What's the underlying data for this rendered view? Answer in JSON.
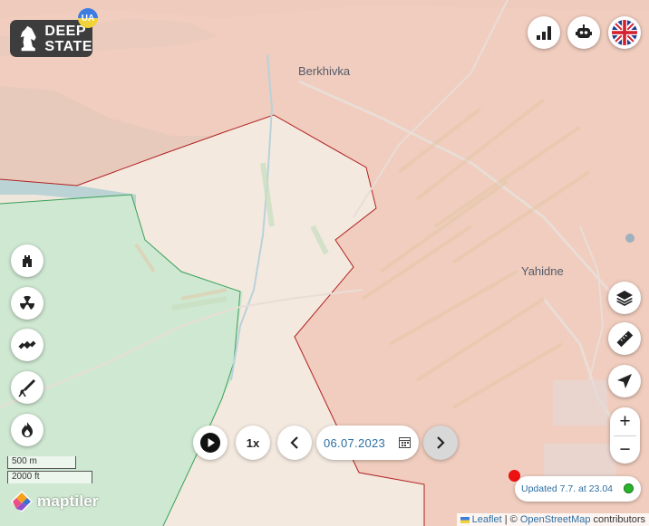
{
  "logo": {
    "line1": "DEEP",
    "line2": "STATE",
    "badge": "UA"
  },
  "places": [
    {
      "name": "Berkhivka"
    },
    {
      "name": "Yahidne"
    }
  ],
  "top_controls": {
    "stats_icon": "bar-chart-icon",
    "bot_icon": "robot-icon",
    "language_icon": "uk-flag-icon"
  },
  "left_tools": [
    "fortification-icon",
    "radiation-icon",
    "satellite-icon",
    "missile-icon",
    "fire-icon"
  ],
  "right_tools": [
    "layers-icon",
    "ruler-icon",
    "locate-icon"
  ],
  "timeline": {
    "speed": "1x",
    "date": "06.07.2023"
  },
  "zoom": {
    "in": "+",
    "out": "−"
  },
  "status": {
    "updated": "Updated 7.7. at 23.04",
    "indicator_color": "#27b52a"
  },
  "scale": {
    "metric": "500 m",
    "imperial": "2000 ft"
  },
  "provider": "maptiler",
  "attribution": {
    "leaflet": "Leaflet",
    "separator": " | © ",
    "osm": "OpenStreetMap",
    "suffix": " contributors"
  },
  "colors": {
    "occupied": "#f0c8b8",
    "liberated": "#cfe8d2",
    "frontline": "#b22222",
    "background": "#efe7dc"
  }
}
